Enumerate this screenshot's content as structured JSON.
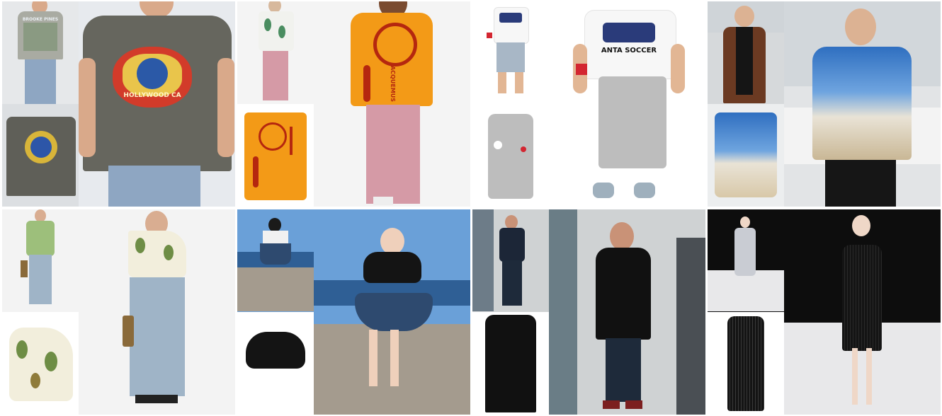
{
  "tiles": [
    {
      "id": "gray-graphic-tee",
      "print_text_top": "BROOKE PINES",
      "print_text_hero": "HOLLYWOOD CA",
      "colors": {
        "bg": "#e7eaee",
        "shirt": "#66665e",
        "jeans": "#8ea6c2",
        "skin": "#d9a98a"
      }
    },
    {
      "id": "orange-print-shirt",
      "print_text": "JACQUEMUS",
      "colors": {
        "bg": "#f4f4f4",
        "shirt": "#f39a17",
        "print": "#b5270f",
        "pants": "#d59aa6",
        "skin": "#7a4b30"
      }
    },
    {
      "id": "kids-soccer-tee",
      "print_text": "ANTA SOCCER",
      "colors": {
        "bg": "#ffffff",
        "tee": "#f7f7f7",
        "pants": "#bdbdbd",
        "skin": "#e2b694",
        "band": "#d32631"
      }
    },
    {
      "id": "blue-resort-shirt",
      "colors": {
        "office": "#e2e4e6",
        "shirt_top": "#2f6fc0",
        "shirt_bottom": "#e9e3d6",
        "jacket": "#6b3a22",
        "skin": "#dcb293"
      }
    },
    {
      "id": "asymmetric-leaf-top",
      "colors": {
        "bg": "#f3f3f3",
        "top": "#f2eedc",
        "leaf": "#6e8d45",
        "jeans": "#9fb4c7",
        "skin": "#d9ad91"
      }
    },
    {
      "id": "black-crop-blue-skirt",
      "colors": {
        "sky": "#6aa0d8",
        "sea": "#2f5f95",
        "wall": "#a49b8e",
        "top": "#141414",
        "skirt": "#2e4a6f",
        "skin": "#efd0bb"
      }
    },
    {
      "id": "black-wool-coat",
      "colors": {
        "street": "#cfd2d3",
        "coat": "#111111",
        "jeans": "#1e2a3a",
        "shoes": "#7c1f1f",
        "skin": "#c99277"
      }
    },
    {
      "id": "black-fringe-dress",
      "colors": {
        "runway": "#0d0d0d",
        "floor": "#e8e8ea",
        "dress": "#141414",
        "skin": "#efd7c7"
      }
    }
  ]
}
